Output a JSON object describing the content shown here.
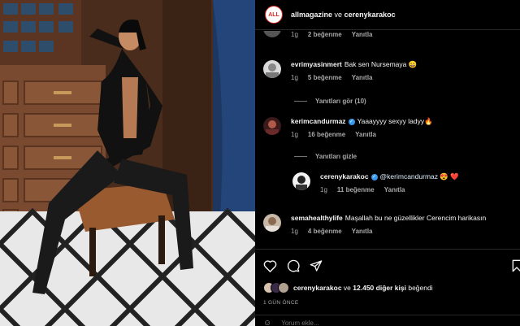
{
  "post": {
    "author": "allmagazine",
    "connector": "ve",
    "collaborator": "cerenykarakoc",
    "avatar_text": "ALL"
  },
  "comments": [
    {
      "username": "",
      "text": "",
      "time": "1g",
      "likes": "2 beğenme",
      "reply": "Yanıtla"
    },
    {
      "username": "evrimyasinmert",
      "text": "Bak sen Nursemaya 😄",
      "time": "1g",
      "likes": "5 beğenme",
      "reply": "Yanıtla"
    },
    {
      "username": "kerimcandurmaz",
      "text": "Yaaayyyy sexyy ladyy🔥",
      "time": "1g",
      "likes": "16 beğenme",
      "reply": "Yanıtla"
    },
    {
      "username": "cerenykarakoc",
      "mention": "@kerimcandurmaz",
      "text": "😍 ❤️",
      "time": "1g",
      "likes": "11 beğenme",
      "reply": "Yanıtla"
    },
    {
      "username": "semahealthylife",
      "text": "Maşallah bu ne güzellikler Cerencim harikasın",
      "time": "1g",
      "likes": "4 beğenme",
      "reply": "Yanıtla"
    }
  ],
  "threads": {
    "show_replies": "Yanıtları gör (10)",
    "hide_replies": "Yanıtları gizle"
  },
  "liked_by": {
    "user": "cerenykarakoc",
    "connector": "ve",
    "others": "12.450 diğer kişi",
    "suffix": "beğendi"
  },
  "timestamp": "1 GÜN ÖNCE",
  "add_comment": {
    "placeholder": "Yorum ekle..."
  },
  "icons": {
    "like": "heart-icon",
    "comment": "comment-icon",
    "share": "share-icon",
    "save": "bookmark-icon",
    "emoji": "emoji-icon",
    "comment_like": "heart-icon"
  },
  "colors": {
    "background": "#000000",
    "verified": "#3897f0",
    "brand_red": "#d7261e",
    "muted": "#a8a8a8"
  }
}
